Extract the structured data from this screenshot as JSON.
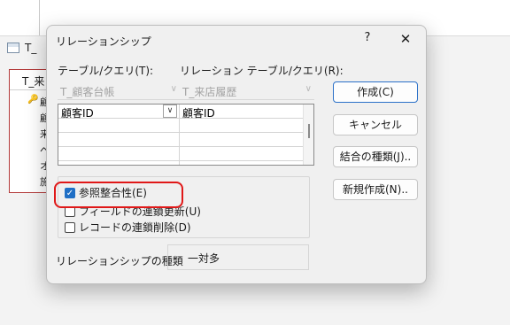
{
  "background": {
    "tab_label": "T_",
    "table": {
      "title": "T_来",
      "fields": [
        "顧",
        "顧",
        "来",
        "ペ",
        "オ",
        "施"
      ]
    }
  },
  "dialog": {
    "title": "リレーションシップ",
    "help_label": "?",
    "close_label": "✕",
    "table_query_label": "テーブル/クエリ(T):",
    "related_table_query_label": "リレーション テーブル/クエリ(R):",
    "table_query_value": "T_顧客台帳",
    "related_table_query_value": "T_来店履歴",
    "fields_grid": {
      "rows": [
        {
          "left": "顧客ID",
          "right": "顧客ID"
        },
        {
          "left": "",
          "right": ""
        },
        {
          "left": "",
          "right": ""
        },
        {
          "left": "",
          "right": ""
        }
      ]
    },
    "options": {
      "referential_integrity": {
        "label": "参照整合性(E)",
        "checked": true
      },
      "cascade_update": {
        "label": "フィールドの連鎖更新(U)",
        "checked": false
      },
      "cascade_delete": {
        "label": "レコードの連鎖削除(D)",
        "checked": false
      }
    },
    "relationship_type_label": "リレーションシップの種類",
    "relationship_type_value": "一対多",
    "buttons": {
      "create": "作成(C)",
      "cancel": "キャンセル",
      "join_type": "結合の種類(J)..",
      "create_new": "新規作成(N).."
    }
  },
  "colors": {
    "accent": "#1f6fc5",
    "highlight": "#e01818",
    "dialog_bg": "#f0f0f0"
  }
}
